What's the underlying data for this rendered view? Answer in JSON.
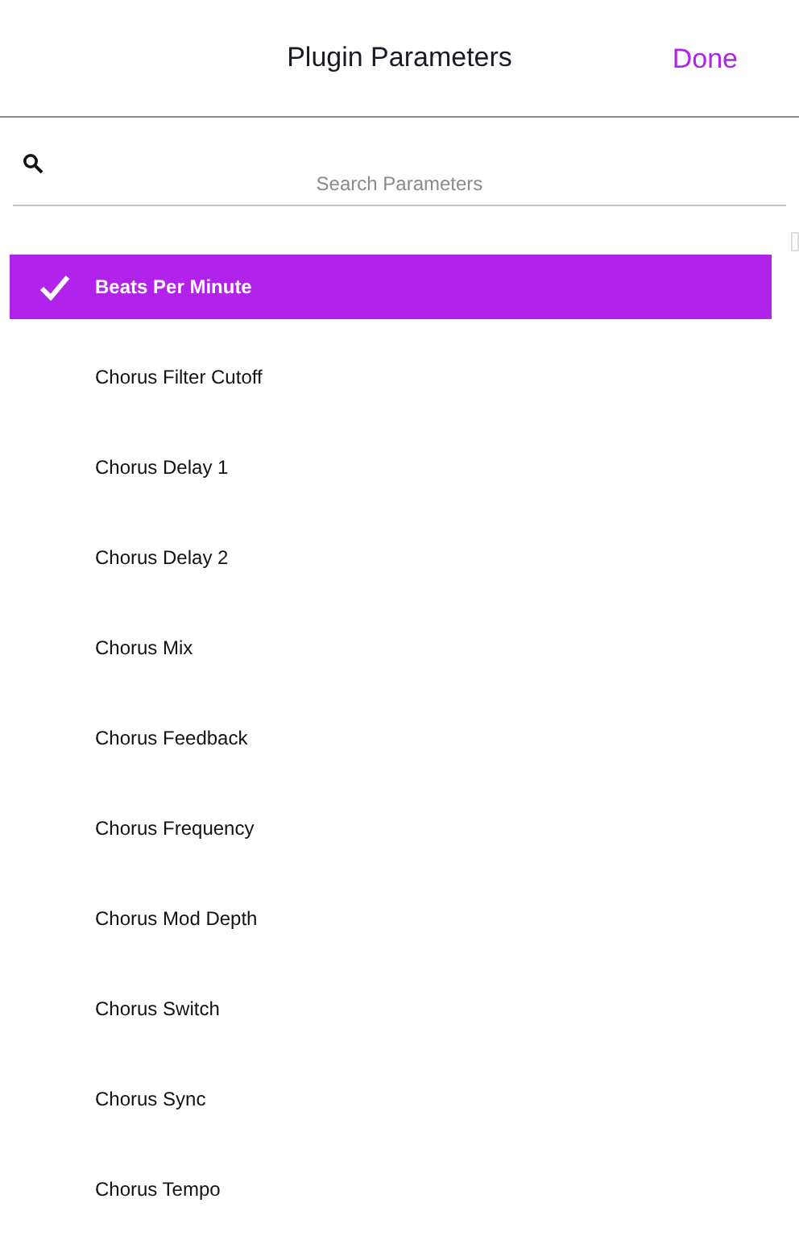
{
  "header": {
    "title": "Plugin Parameters",
    "done": "Done"
  },
  "search": {
    "placeholder": "Search Parameters"
  },
  "parameters": [
    {
      "label": "Beats Per Minute",
      "selected": true
    },
    {
      "label": "Chorus Filter Cutoff",
      "selected": false
    },
    {
      "label": "Chorus Delay 1",
      "selected": false
    },
    {
      "label": "Chorus Delay 2",
      "selected": false
    },
    {
      "label": "Chorus Mix",
      "selected": false
    },
    {
      "label": "Chorus Feedback",
      "selected": false
    },
    {
      "label": "Chorus Frequency",
      "selected": false
    },
    {
      "label": "Chorus Mod Depth",
      "selected": false
    },
    {
      "label": "Chorus Switch",
      "selected": false
    },
    {
      "label": "Chorus Sync",
      "selected": false
    },
    {
      "label": "Chorus Tempo",
      "selected": false
    }
  ]
}
